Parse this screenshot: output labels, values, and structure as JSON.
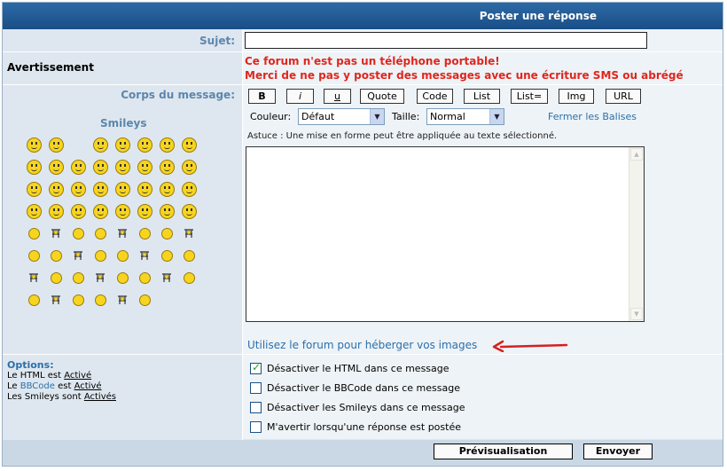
{
  "header": {
    "title": "Poster une réponse"
  },
  "subject": {
    "label": "Sujet:",
    "value": ""
  },
  "warning": {
    "title": "Avertissement",
    "line1": "Ce forum n'est pas un téléphone portable!",
    "line2": "Merci de ne pas y poster des messages avec une écriture SMS ou abrégé"
  },
  "body": {
    "label": "Corps du message:",
    "smileys_title": "Smileys",
    "bbcode_buttons": [
      "B",
      "i",
      "u",
      "Quote",
      "Code",
      "List",
      "List=",
      "Img",
      "URL"
    ],
    "color_label": "Couleur:",
    "color_value": "Défaut",
    "size_label": "Taille:",
    "size_value": "Normal",
    "close_tags": "Fermer les Balises",
    "tip": "Astuce : Une mise en forme peut être appliquée au texte sélectionné.",
    "text": "",
    "host_link": "Utilisez le forum pour héberger vos images"
  },
  "options": {
    "title": "Options:",
    "html_prefix": "Le HTML est",
    "html_status": "Activé",
    "bbcode_prefix": "Le",
    "bbcode_link": "BBCode",
    "bbcode_mid": "est",
    "bbcode_status": "Activé",
    "smileys_prefix": "Les Smileys sont",
    "smileys_status": "Activés",
    "checkboxes": [
      {
        "label": "Désactiver le HTML dans ce message",
        "checked": true
      },
      {
        "label": "Désactiver le BBCode dans ce message",
        "checked": false
      },
      {
        "label": "Désactiver les Smileys dans ce message",
        "checked": false
      },
      {
        "label": "M'avertir lorsqu'une réponse est postée",
        "checked": false
      }
    ]
  },
  "footer": {
    "preview": "Prévisualisation",
    "send": "Envoyer"
  },
  "colors": {
    "header": "#1f5a96",
    "warning": "#e0261c",
    "link": "#2c6fa8",
    "label": "#5d86ad",
    "panel": "#dee7ef",
    "annotation_arrow": "#d42020"
  }
}
